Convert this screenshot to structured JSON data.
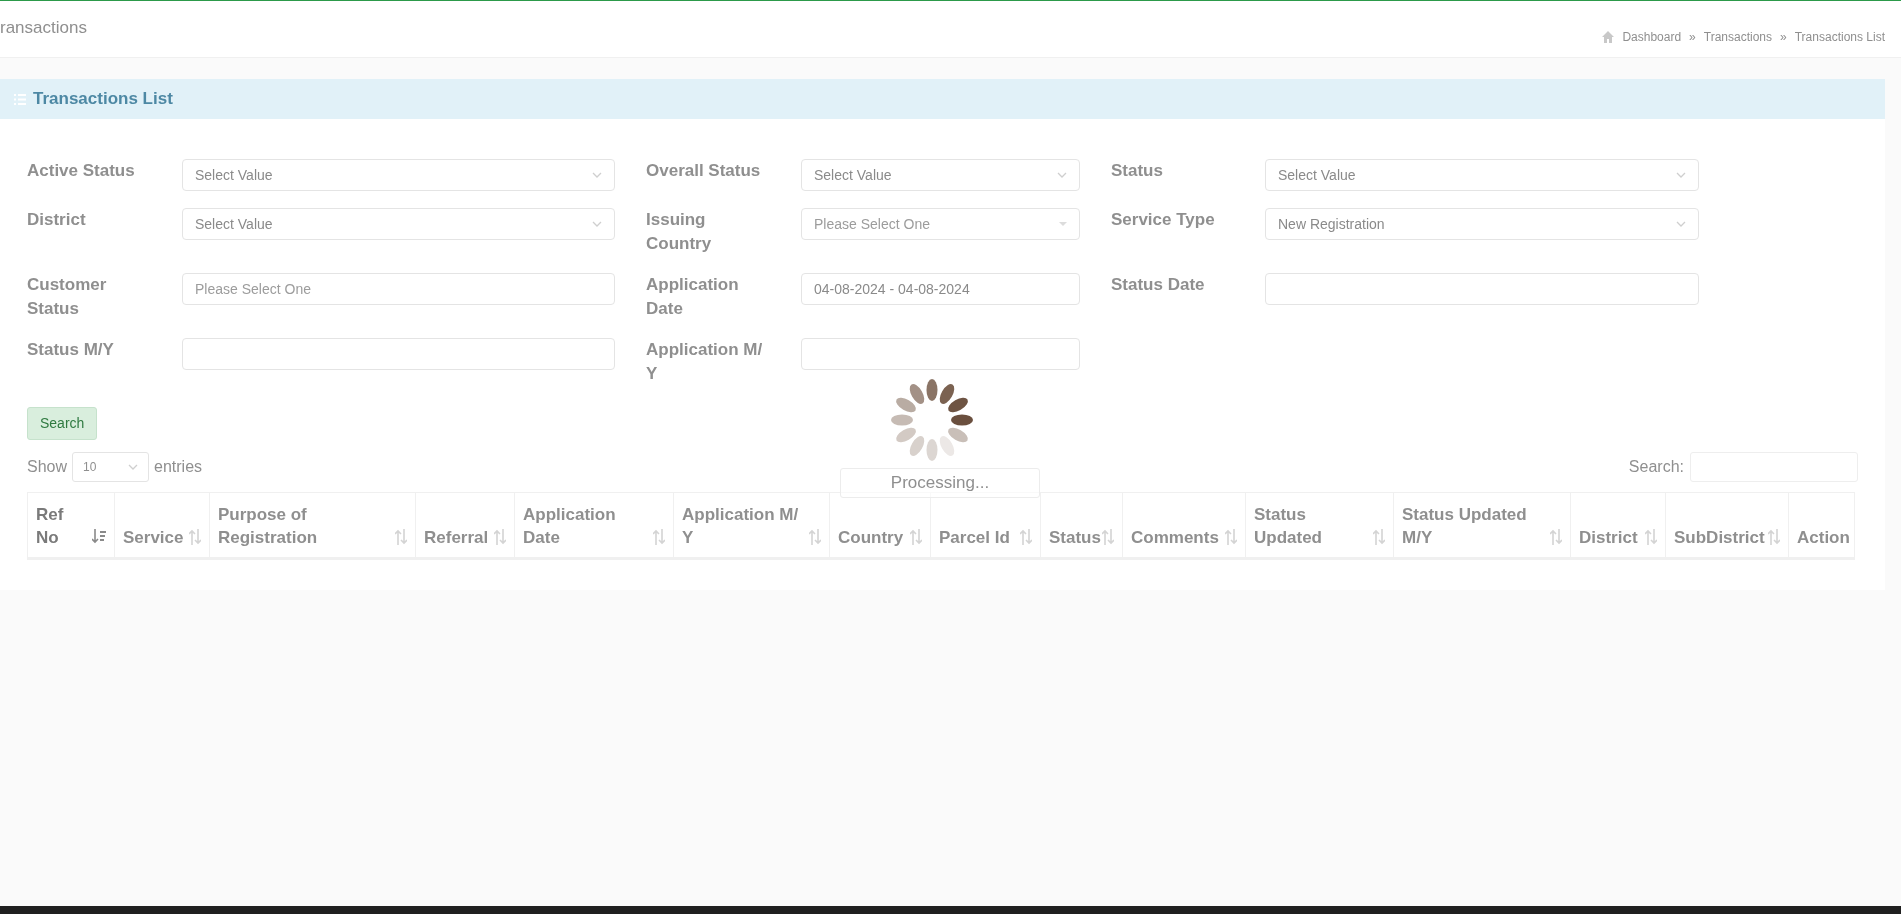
{
  "page": {
    "title": "ransactions"
  },
  "breadcrumb": [
    {
      "label": "Dashboard"
    },
    {
      "label": "Transactions"
    },
    {
      "label": "Transactions List"
    }
  ],
  "breadcrumb_separator": "»",
  "panel": {
    "title": "Transactions List"
  },
  "filters": [
    {
      "label": "Active Status",
      "kind": "select",
      "value": "Select Value"
    },
    {
      "label": "Overall Status",
      "kind": "select",
      "value": "Select Value"
    },
    {
      "label": "Status",
      "kind": "select",
      "value": "Select Value"
    },
    {
      "label": "District",
      "kind": "select",
      "value": "Select Value"
    },
    {
      "label": "Issuing Country",
      "kind": "combo",
      "placeholder": "Please Select One"
    },
    {
      "label": "Service Type",
      "kind": "select",
      "value": "New Registration"
    },
    {
      "label": "Customer Status",
      "kind": "text",
      "placeholder": "Please Select One"
    },
    {
      "label": "Application Date",
      "kind": "text",
      "value": "04-08-2024 - 04-08-2024"
    },
    {
      "label": "Status Date",
      "kind": "text"
    },
    {
      "label": "Status M/Y",
      "kind": "text"
    },
    {
      "label": "Application M/ Y",
      "kind": "text"
    }
  ],
  "search_button": "Search",
  "length_menu": {
    "before": "Show",
    "value": "10",
    "after": "entries"
  },
  "table_search": {
    "label": "Search:"
  },
  "table": {
    "columns": [
      {
        "label": "Ref No",
        "sortable": true,
        "sorted": true
      },
      {
        "label": "Service",
        "sortable": true,
        "sorted": false
      },
      {
        "label": "Purpose of Registration",
        "sortable": true,
        "sorted": false
      },
      {
        "label": "Referral",
        "sortable": true,
        "sorted": false
      },
      {
        "label": "Application Date",
        "sortable": true,
        "sorted": false
      },
      {
        "label": "Application M/ Y",
        "sortable": true,
        "sorted": false
      },
      {
        "label": "Country",
        "sortable": true,
        "sorted": false
      },
      {
        "label": "Parcel Id",
        "sortable": true,
        "sorted": false
      },
      {
        "label": "Status",
        "sortable": true,
        "sorted": false
      },
      {
        "label": "Comments",
        "sortable": true,
        "sorted": false
      },
      {
        "label": "Status Updated",
        "sortable": true,
        "sorted": false
      },
      {
        "label": "Status Updated M/Y",
        "sortable": true,
        "sorted": false
      },
      {
        "label": "District",
        "sortable": true,
        "sorted": false
      },
      {
        "label": "SubDistrict",
        "sortable": true,
        "sorted": false
      },
      {
        "label": "Action",
        "sortable": false
      }
    ]
  },
  "processing": "Processing..."
}
